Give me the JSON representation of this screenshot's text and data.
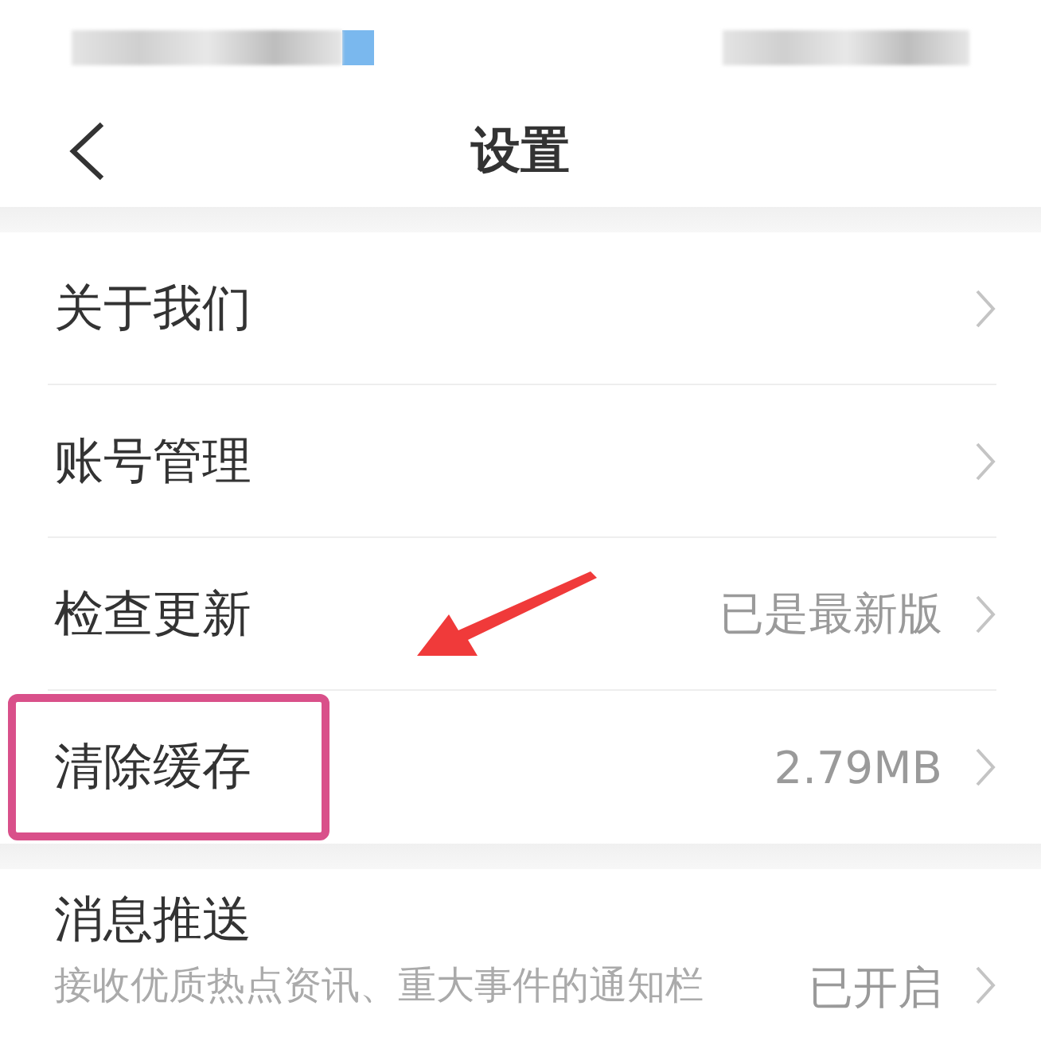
{
  "header": {
    "title": "设置"
  },
  "groups": [
    [
      {
        "label": "关于我们",
        "highlighted": false
      },
      {
        "label": "账号管理",
        "highlighted": false
      },
      {
        "label": "检查更新",
        "value": "已是最新版",
        "highlighted": false
      },
      {
        "label": "清除缓存",
        "value": "2.79MB",
        "highlighted": true
      }
    ],
    [
      {
        "label": "消息推送",
        "subtitle": "接收优质热点资讯、重大事件的通知栏",
        "value": "已开启",
        "highlighted": false
      }
    ]
  ]
}
